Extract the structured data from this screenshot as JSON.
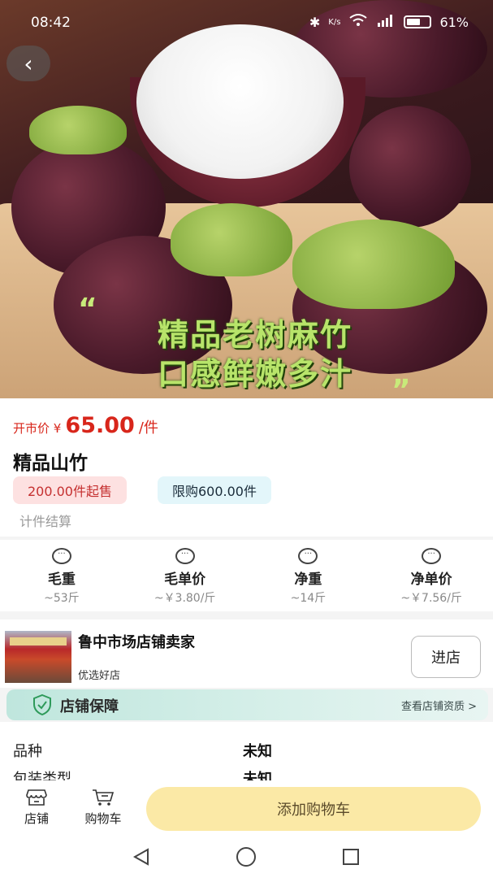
{
  "status_bar": {
    "time": "08:42",
    "network_speed": "K/s",
    "battery": "61%"
  },
  "hero": {
    "line1": "精品老树麻竹",
    "line2": "口感鲜嫩多汁",
    "quote_open": "“",
    "quote_close": "”"
  },
  "product": {
    "price_prefix": "开市价 ¥",
    "price": "65.00",
    "price_unit": "/件",
    "name": "精品山竹",
    "min_order": "200.00件起售",
    "purchase_limit": "限购600.00件",
    "settlement": "计件结算"
  },
  "weights": [
    {
      "label": "毛重",
      "value": "~53斤"
    },
    {
      "label": "毛单价",
      "value": "~￥3.80/斤"
    },
    {
      "label": "净重",
      "value": "~14斤"
    },
    {
      "label": "净单价",
      "value": "~￥7.56/斤"
    }
  ],
  "shop": {
    "name": "鲁中市场店铺卖家",
    "subtitle": "优选好店",
    "enter_label": "进店"
  },
  "guarantee": {
    "title": "店铺保障",
    "link": "查看店铺资质 >"
  },
  "attributes": [
    {
      "key": "品种",
      "value": "未知"
    },
    {
      "key": "包装类型",
      "value": "未知"
    }
  ],
  "bottom_bar": {
    "shop_tab": "店铺",
    "cart_tab": "购物车",
    "add_to_cart": "添加购物车"
  },
  "colors": {
    "price_red": "#d8261b",
    "add_cart_bg": "#fbe9a6",
    "guarantee_bg": "#bfe6dd"
  }
}
